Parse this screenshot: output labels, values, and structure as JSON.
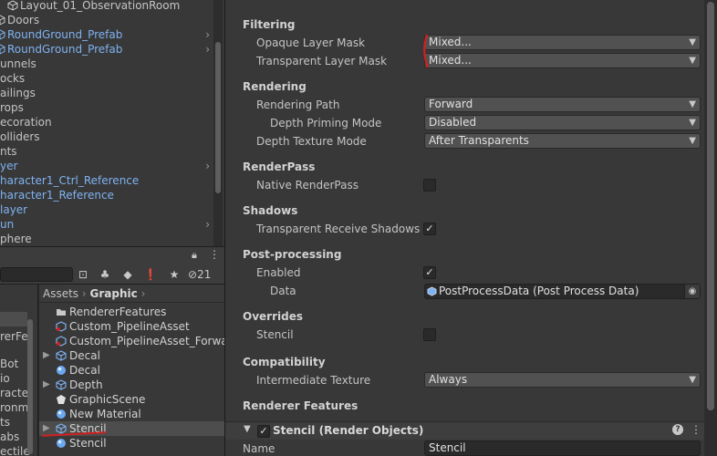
{
  "hierarchy": {
    "rows": [
      {
        "label": "Layout_01_ObservationRoom",
        "blue": false,
        "cube": true,
        "arrow": false
      },
      {
        "label": "Doors",
        "blue": false,
        "cube": true,
        "arrow": false
      },
      {
        "label": "RoundGround_Prefab",
        "blue": true,
        "cube": true,
        "arrow": true
      },
      {
        "label": "RoundGround_Prefab",
        "blue": true,
        "cube": true,
        "arrow": true
      },
      {
        "label": "unnels",
        "blue": false,
        "cube": false,
        "arrow": false
      },
      {
        "label": "ocks",
        "blue": false,
        "cube": false,
        "arrow": false
      },
      {
        "label": "ailings",
        "blue": false,
        "cube": false,
        "arrow": false
      },
      {
        "label": "rops",
        "blue": false,
        "cube": false,
        "arrow": false
      },
      {
        "label": "ecoration",
        "blue": false,
        "cube": false,
        "arrow": false
      },
      {
        "label": "olliders",
        "blue": false,
        "cube": false,
        "arrow": false
      },
      {
        "label": "nts",
        "blue": false,
        "cube": false,
        "arrow": false
      },
      {
        "label": "yer",
        "blue": true,
        "cube": false,
        "arrow": true
      },
      {
        "label": "haracter1_Ctrl_Reference",
        "blue": true,
        "cube": false,
        "arrow": false
      },
      {
        "label": "haracter1_Reference",
        "blue": true,
        "cube": false,
        "arrow": false
      },
      {
        "label": "layer",
        "blue": true,
        "cube": false,
        "arrow": false
      },
      {
        "label": "un",
        "blue": true,
        "cube": false,
        "arrow": true
      },
      {
        "label": "phere",
        "blue": false,
        "cube": false,
        "arrow": false
      }
    ]
  },
  "project": {
    "hidden_count": "21",
    "breadcrumb": {
      "root": "Assets",
      "sep": "›",
      "current": "Graphic"
    },
    "left_items": [
      "rerFe",
      "Bot",
      "io",
      "racte",
      "ronm",
      "ts",
      "abs",
      "ectile"
    ],
    "items": [
      {
        "label": "RendererFeatures",
        "icon": "folder-icon",
        "fold": false,
        "selected": false
      },
      {
        "label": "Custom_PipelineAsset",
        "icon": "pipeline-asset-icon",
        "fold": false,
        "selected": false
      },
      {
        "label": "Custom_PipelineAsset_Forwar",
        "icon": "pipeline-asset-icon",
        "fold": false,
        "selected": false
      },
      {
        "label": "Decal",
        "icon": "prefab-icon",
        "fold": true,
        "selected": false
      },
      {
        "label": "Decal",
        "icon": "material-icon",
        "fold": false,
        "selected": false
      },
      {
        "label": "Depth",
        "icon": "prefab-icon",
        "fold": true,
        "selected": false
      },
      {
        "label": "GraphicScene",
        "icon": "scene-icon",
        "fold": false,
        "selected": false
      },
      {
        "label": "New Material",
        "icon": "material-icon",
        "fold": false,
        "selected": false
      },
      {
        "label": "Stencil",
        "icon": "prefab-icon",
        "fold": true,
        "selected": true
      },
      {
        "label": "Stencil",
        "icon": "material-icon",
        "fold": false,
        "selected": false
      }
    ]
  },
  "inspector": {
    "filtering": {
      "header": "Filtering",
      "opaque_label": "Opaque Layer Mask",
      "opaque_value": "Mixed...",
      "transparent_label": "Transparent Layer Mask",
      "transparent_value": "Mixed..."
    },
    "rendering": {
      "header": "Rendering",
      "path_label": "Rendering Path",
      "path_value": "Forward",
      "priming_label": "Depth Priming Mode",
      "priming_value": "Disabled",
      "depth_tex_label": "Depth Texture Mode",
      "depth_tex_value": "After Transparents"
    },
    "renderpass": {
      "header": "RenderPass",
      "native_label": "Native RenderPass",
      "native_checked": false
    },
    "shadows": {
      "header": "Shadows",
      "trs_label": "Transparent Receive Shadows",
      "trs_checked": true
    },
    "postprocessing": {
      "header": "Post-processing",
      "enabled_label": "Enabled",
      "enabled_checked": true,
      "data_label": "Data",
      "data_value": "PostProcessData (Post Process Data)"
    },
    "overrides": {
      "header": "Overrides",
      "stencil_label": "Stencil",
      "stencil_checked": false
    },
    "compatibility": {
      "header": "Compatibility",
      "intermediate_label": "Intermediate Texture",
      "intermediate_value": "Always"
    },
    "renderer_features": {
      "header": "Renderer Features",
      "feature_title": "Stencil (Render Objects)",
      "feature_enabled": true,
      "name_label": "Name",
      "name_value": "Stencil"
    }
  },
  "colors": {
    "accent_blue": "#7fb2f0",
    "annotation_red": "#d21f1f",
    "panel_bg": "#383838"
  }
}
